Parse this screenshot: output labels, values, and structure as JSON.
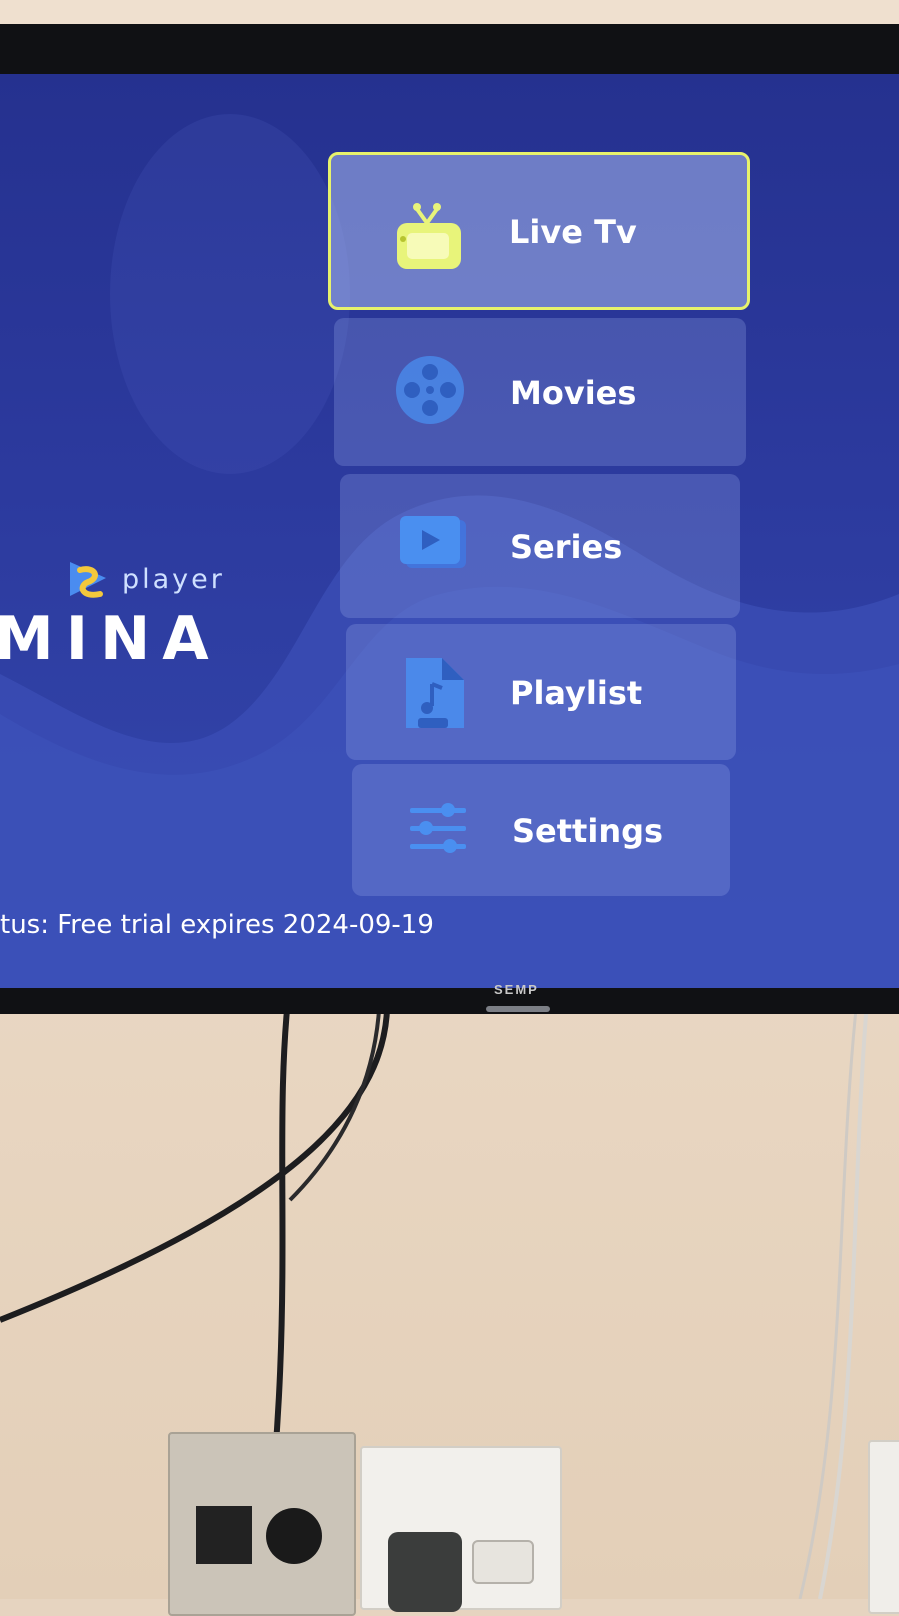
{
  "app": {
    "brand_small": "player",
    "brand_name": "MINA"
  },
  "menu": [
    {
      "label": "Live Tv",
      "icon": "tv-icon",
      "active": true
    },
    {
      "label": "Movies",
      "icon": "film-reel-icon",
      "active": false
    },
    {
      "label": "Series",
      "icon": "play-stack-icon",
      "active": false
    },
    {
      "label": "Playlist",
      "icon": "music-file-icon",
      "active": false
    },
    {
      "label": "Settings",
      "icon": "sliders-icon",
      "active": false
    }
  ],
  "status": {
    "text": "tus: Free trial expires 2024-09-19"
  },
  "tv": {
    "brand": "SEMP"
  },
  "colors": {
    "focus_border": "#e7f26c",
    "screen_bg": "#2c3a9e",
    "tv_icon": "#e8f47a",
    "menu_icon": "#4a8ff0"
  }
}
